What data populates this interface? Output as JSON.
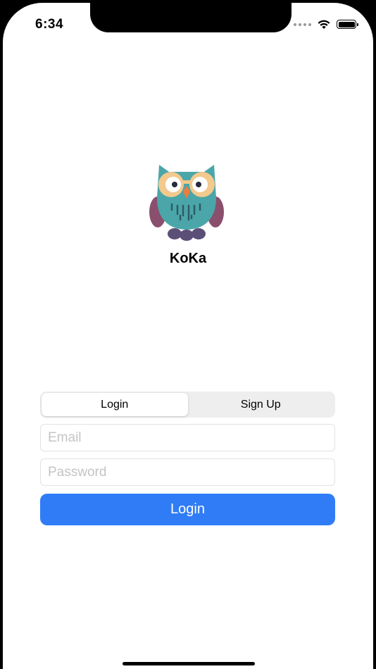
{
  "status_bar": {
    "time": "6:34",
    "icons": [
      "signal-dots-icon",
      "wifi-icon",
      "battery-icon"
    ]
  },
  "app": {
    "name": "KoKa",
    "logo_icon": "owl-logo-icon"
  },
  "auth_tabs": {
    "items": [
      {
        "label": "Login",
        "selected": true
      },
      {
        "label": "Sign Up",
        "selected": false
      }
    ]
  },
  "form": {
    "email": {
      "value": "",
      "placeholder": "Email"
    },
    "password": {
      "value": "",
      "placeholder": "Password"
    },
    "submit_label": "Login"
  },
  "colors": {
    "accent": "#2f7cf6",
    "owl_body": "#4aa6a8",
    "owl_wing": "#8b4f6e",
    "owl_glasses": "#f3c98d",
    "owl_beak": "#f07a3c"
  }
}
